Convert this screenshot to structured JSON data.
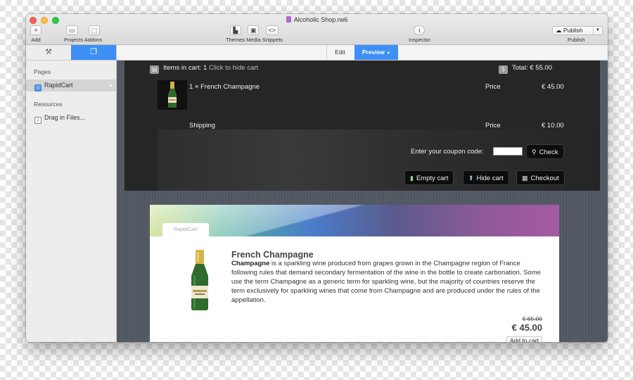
{
  "window": {
    "title": "Alcoholic Shop.rw6"
  },
  "toolbar": {
    "add": {
      "icon": "plus-icon",
      "label": "Add"
    },
    "projects": {
      "icon": "projects-icon",
      "label": "Projects"
    },
    "addons": {
      "icon": "addons-icon",
      "label": "Addons"
    },
    "themes": {
      "icon": "themes-icon",
      "label": "Themes"
    },
    "media": {
      "icon": "media-icon",
      "label": "Media"
    },
    "snippets": {
      "icon": "snippets-icon",
      "label": "Snippets",
      "glyph": "<>"
    },
    "inspector": {
      "icon": "info-icon",
      "label": "Inspector"
    },
    "publish": {
      "icon": "publish-icon",
      "button_label": "Publish",
      "label": "Publish"
    }
  },
  "sidebar": {
    "pages_heading": "Pages",
    "pages": [
      {
        "label": "RapidCart",
        "selected": true
      }
    ],
    "resources_heading": "Resources",
    "resources": [
      {
        "label": "Drag in Files..."
      }
    ]
  },
  "modebar": {
    "edit_label": "Edit",
    "preview_label": "Preview"
  },
  "cart": {
    "items_label": "Items in cart:",
    "items_count": "1",
    "hide_hint": "Click to hide cart",
    "total_label": "Total:",
    "total_value": "€ 55.00",
    "line_item": "1 × French Champagne",
    "line_price_label": "Price",
    "line_price": "€ 45.00",
    "shipping_label": "Shipping",
    "shipping_price_label": "Price",
    "shipping_price": "€ 10.00",
    "coupon_label": "Enter your coupon code:",
    "coupon_value": "",
    "check_button": "Check",
    "empty_button": "Empty cart",
    "hide_button": "Hide cart",
    "checkout_button": "Checkout"
  },
  "product": {
    "tab_label": "RapidCart",
    "title": "French Champagne",
    "desc_bold": "Champagne",
    "desc_rest": " is a sparkling wine produced from grapes grown in the Champagne region of France following rules that demand secondary fermentation of the wine in the bottle to create carbonation. Some use the term Champagne as a generic term for sparkling wine, but the majority of countries reserve the term exclusively for sparkling wines that come from Champagne and are produced under the rules of the appellation.",
    "old_price": "€ 65.00",
    "price": "€ 45.00",
    "add_button": "Add to cart"
  },
  "colors": {
    "accent": "#3d8ff5",
    "cart_background": "#262626",
    "bottle_green": "#2f6b2c",
    "bottle_foil": "#d4b14a"
  }
}
